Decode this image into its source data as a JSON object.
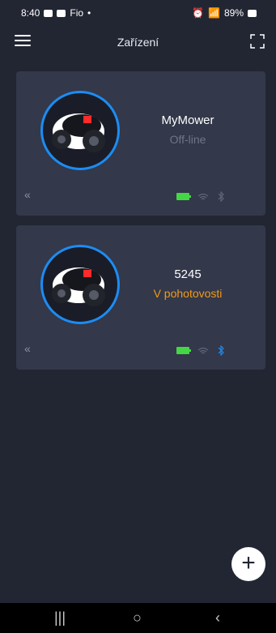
{
  "status_bar": {
    "time": "8:40",
    "bank_app": "Fio",
    "dot": "•",
    "battery_percent": "89%"
  },
  "app_bar": {
    "title": "Zařízení",
    "menu_icon": "menu-icon",
    "fullscreen_icon": "fullscreen-icon"
  },
  "devices": [
    {
      "name": "MyMower",
      "status": "Off-line",
      "status_color": "#6f7586",
      "battery": "battery-icon",
      "wifi": "wifi-icon",
      "bluetooth": "bluetooth-icon",
      "bluetooth_color": "#60677a"
    },
    {
      "name": "5245",
      "status": "V pohotovosti",
      "status_color": "#f29b17",
      "battery": "battery-icon",
      "wifi": "wifi-icon",
      "bluetooth": "bluetooth-icon",
      "bluetooth_color": "#1c8cf3"
    }
  ],
  "fab": {
    "label": "+"
  },
  "nav": {
    "recents": "|||",
    "home": "○",
    "back": "‹"
  }
}
